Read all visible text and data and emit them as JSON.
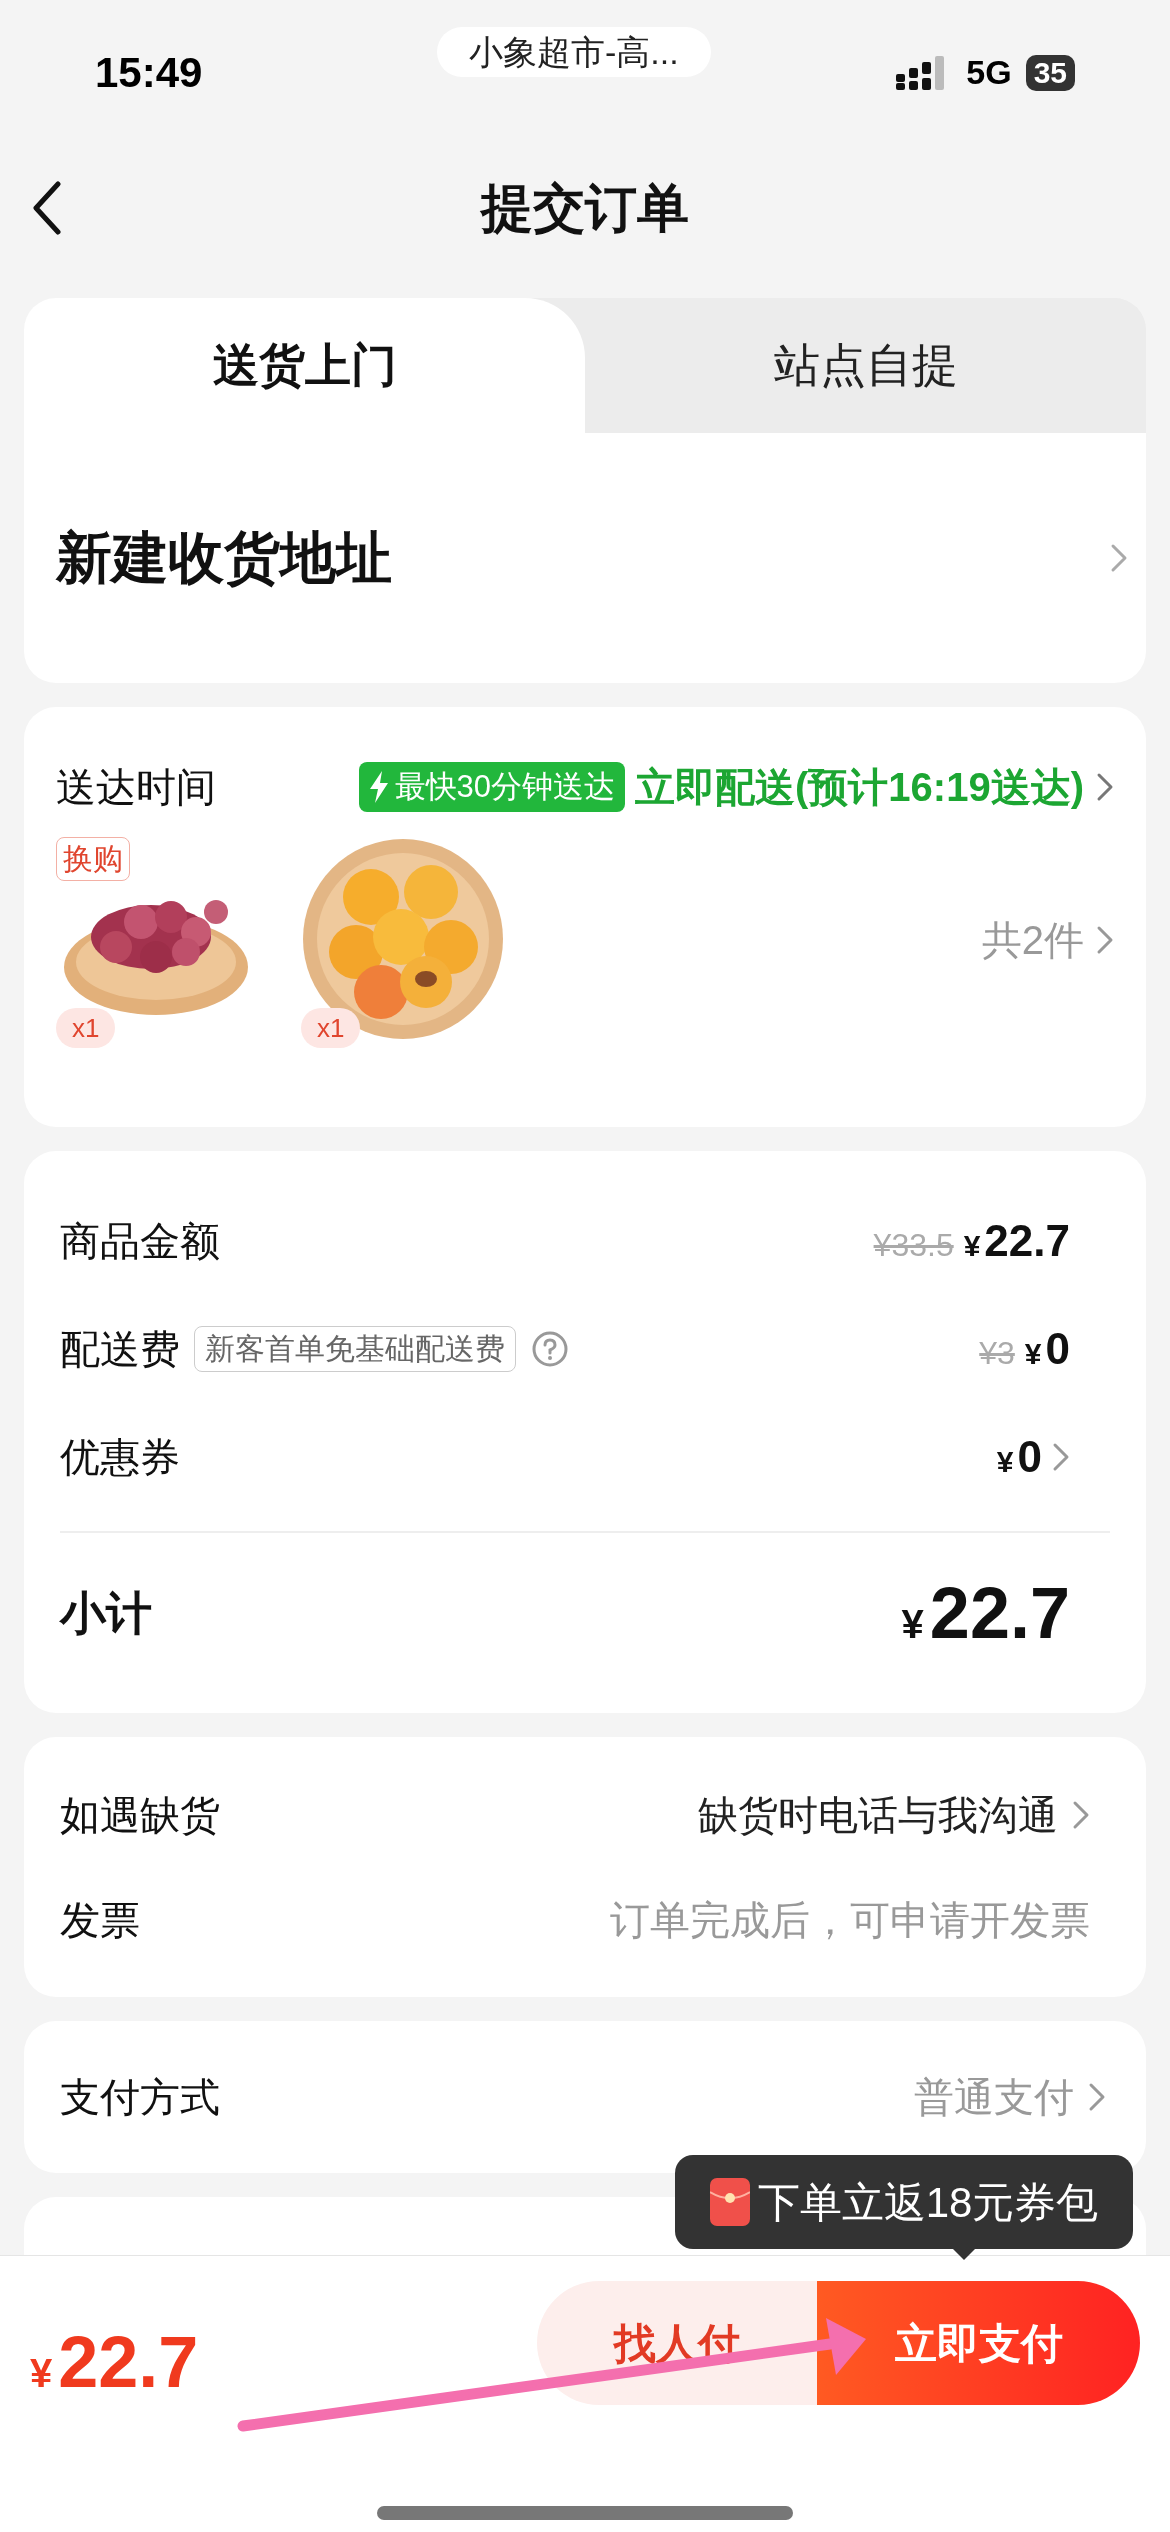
{
  "status_bar": {
    "time": "15:49",
    "app_pill": "小象超市-高...",
    "network": "5G",
    "battery": "35"
  },
  "nav": {
    "title": "提交订单"
  },
  "tabs": [
    {
      "label": "送货上门",
      "selected": true
    },
    {
      "label": "站点自提",
      "selected": false
    }
  ],
  "address": {
    "label": "新建收货地址"
  },
  "delivery": {
    "label": "送达时间",
    "badge": "最快30分钟送达",
    "option": "立即配送(预计16:19送达)",
    "count": "共2件",
    "items": [
      {
        "kind": "picture",
        "tag": "换购",
        "quantity": "x1"
      },
      {
        "kind": "picture",
        "quantity": "x1"
      }
    ]
  },
  "fees": {
    "rows": [
      {
        "label": "商品金额",
        "original": "¥33.5",
        "currency": "¥",
        "amount": "22.7",
        "chevron": false
      },
      {
        "label": "配送费",
        "tag": "新客首单免基础配送费",
        "help": true,
        "original": "¥3",
        "currency": "¥",
        "amount": "0",
        "chevron": false
      },
      {
        "label": "优惠券",
        "currency": "¥",
        "amount": "0",
        "chevron": true
      }
    ],
    "subtotal": {
      "label": "小计",
      "currency": "¥",
      "amount": "22.7"
    }
  },
  "options": [
    {
      "label": "如遇缺货",
      "value": "缺货时电话与我沟通",
      "chevron": true
    },
    {
      "label": "发票",
      "value": "订单完成后，可申请开发票",
      "chevron": false
    }
  ],
  "payment": {
    "label": "支付方式",
    "value": "普通支付"
  },
  "bottom": {
    "currency": "¥",
    "total": "22.7",
    "tooltip": "下单立返18元券包",
    "secondary": "找人付",
    "primary": "立即支付"
  }
}
